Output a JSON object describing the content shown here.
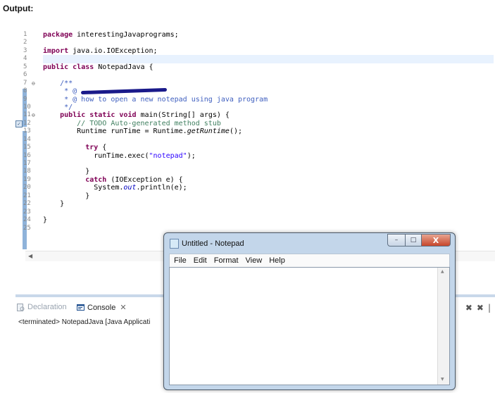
{
  "heading": "Output:",
  "editor": {
    "line_numbers": [
      "1",
      "2",
      "3",
      "4",
      "5",
      "6",
      "7",
      "8",
      "9",
      "10",
      "11",
      "12",
      "13",
      "14",
      "15",
      "16",
      "17",
      "18",
      "19",
      "20",
      "21",
      "22",
      "23",
      "24",
      "25"
    ],
    "fold_markers": {
      "7": "⊖",
      "11": "⊖"
    },
    "lines": {
      "l1": {
        "kw": "package",
        "rest": " interestingJavaprograms;"
      },
      "l3": {
        "kw": "import",
        "rest": " java.io.IOException;"
      },
      "l5": {
        "kw1": "public",
        "kw2": "class",
        "rest": " NotepadJava {"
      },
      "l7": "    /**",
      "l8": "     * @ ",
      "l9": "     * @ how to open a new notepad using java program",
      "l10": "     */",
      "l11": {
        "kw1": "public",
        "kw2": "static",
        "kw3": "void",
        "rest": " main(String[] args) {"
      },
      "l12": "        // TODO Auto-generated method stub",
      "l13": {
        "pre": "        Runtime runTime = Runtime.",
        "it": "getRuntime",
        "post": "();"
      },
      "l15": {
        "pre": "          ",
        "kw": "try",
        "rest": " {"
      },
      "l16": {
        "pre": "            runTime.exec(",
        "str": "\"notepad\"",
        "post": ");"
      },
      "l18": "          }",
      "l19": {
        "pre": "          ",
        "kw": "catch",
        "rest": " (IOException e) {"
      },
      "l20": {
        "pre": "            System.",
        "fld": "out",
        "post": ".println(e);"
      },
      "l21": "          }",
      "l22": "    }",
      "l24": "}"
    }
  },
  "bottom_panel": {
    "tabs": [
      {
        "label": "Declaration"
      },
      {
        "label": "Console",
        "close": "✕"
      }
    ],
    "terminated_text": "<terminated> NotepadJava [Java Applicati"
  },
  "notepad": {
    "title": "Untitled - Notepad",
    "menu": [
      "File",
      "Edit",
      "Format",
      "View",
      "Help"
    ],
    "buttons": {
      "minimize": "–",
      "maximize": "□",
      "close": "X"
    }
  }
}
